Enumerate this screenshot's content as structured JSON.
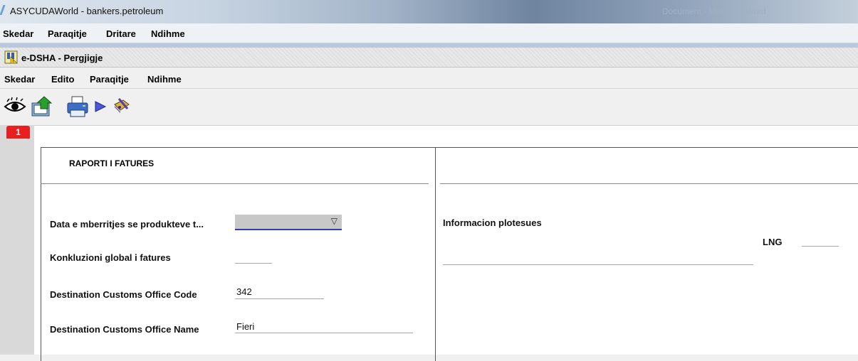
{
  "app": {
    "title": "ASYCUDAWorld - bankers.petroleum",
    "ghost_title": "Document - Microsoft Word",
    "menu": [
      "Skedar",
      "Paraqitje",
      "Dritare",
      "Ndihme"
    ]
  },
  "window": {
    "title": "e-DSHA - Pergjigje",
    "menu": [
      "Skedar",
      "Edito",
      "Paraqitje",
      "Ndihme"
    ]
  },
  "toolbar": {
    "icons": [
      "eye-icon",
      "export-icon",
      "print-icon",
      "play-icon",
      "book-pencil-icon"
    ]
  },
  "tab": {
    "label": "1",
    "color": "#e81f1f"
  },
  "form": {
    "section_title": "RAPORTI I FATURES",
    "fields": [
      {
        "label": "Data e mberritjes se produkteve t...",
        "value": "",
        "type": "select"
      },
      {
        "label": "Konkluzioni global i fatures",
        "value": ""
      },
      {
        "label": "Destination Customs Office Code",
        "value": "342"
      },
      {
        "label": "Destination Customs Office Name",
        "value": "Fieri"
      }
    ],
    "info_label": "Informacion plotesues",
    "info_value": "",
    "lng_label": "LNG",
    "lng_value": ""
  },
  "colors": {
    "accent_blue": "#2a3dbf",
    "tab_red": "#e81f1f"
  }
}
